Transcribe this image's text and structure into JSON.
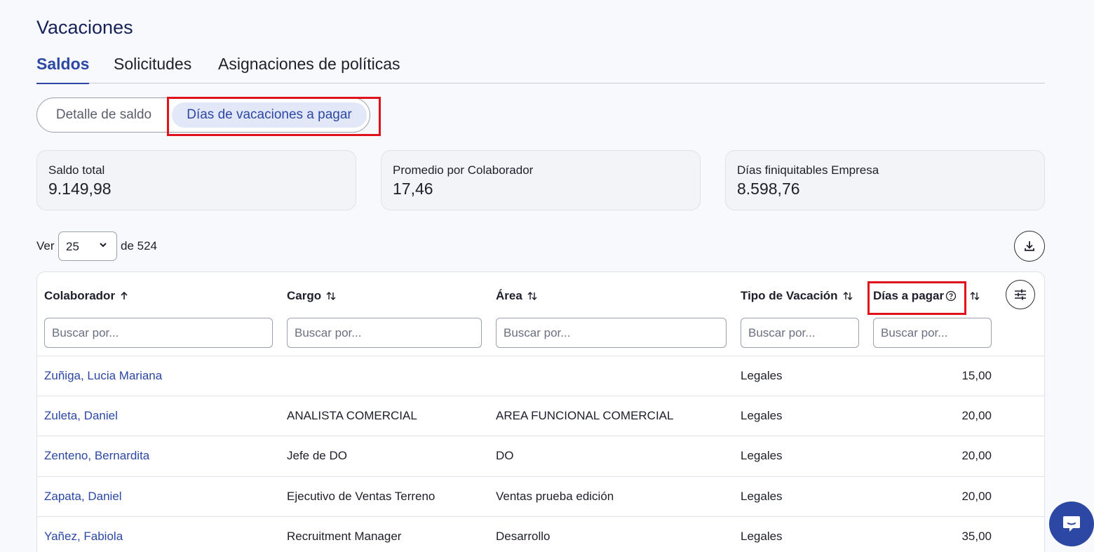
{
  "page_title": "Vacaciones",
  "tabs": [
    {
      "label": "Saldos",
      "active": true
    },
    {
      "label": "Solicitudes",
      "active": false
    },
    {
      "label": "Asignaciones de políticas",
      "active": false
    }
  ],
  "segmented": [
    {
      "label": "Detalle de saldo",
      "active": false
    },
    {
      "label": "Días de vacaciones a pagar",
      "active": true
    }
  ],
  "cards": [
    {
      "label": "Saldo total",
      "value": "9.149,98"
    },
    {
      "label": "Promedio por Colaborador",
      "value": "17,46"
    },
    {
      "label": "Días finiquitables Empresa",
      "value": "8.598,76"
    }
  ],
  "pager": {
    "prefix": "Ver",
    "page_size": "25",
    "suffix": "de 524"
  },
  "columns": [
    {
      "label": "Colaborador",
      "sort": "asc",
      "placeholder": "Buscar por..."
    },
    {
      "label": "Cargo",
      "sort": "none",
      "placeholder": "Buscar por..."
    },
    {
      "label": "Área",
      "sort": "none",
      "placeholder": "Buscar por..."
    },
    {
      "label": "Tipo de Vacación",
      "sort": "none",
      "placeholder": "Buscar por..."
    },
    {
      "label": "Días a pagar",
      "sort": "none",
      "placeholder": "Buscar por..."
    }
  ],
  "rows": [
    {
      "colaborador": "Zuñiga, Lucia Mariana",
      "cargo": "",
      "area": "",
      "tipo": "Legales",
      "dias": "15,00"
    },
    {
      "colaborador": "Zuleta, Daniel",
      "cargo": "ANALISTA COMERCIAL",
      "area": "AREA FUNCIONAL COMERCIAL",
      "tipo": "Legales",
      "dias": "20,00"
    },
    {
      "colaborador": "Zenteno, Bernardita",
      "cargo": "Jefe de DO",
      "area": "DO",
      "tipo": "Legales",
      "dias": "20,00"
    },
    {
      "colaborador": "Zapata, Daniel",
      "cargo": "Ejecutivo de Ventas Terreno",
      "area": "Ventas prueba edición",
      "tipo": "Legales",
      "dias": "20,00"
    },
    {
      "colaborador": "Yañez, Fabiola",
      "cargo": "Recruitment Manager",
      "area": "Desarrollo",
      "tipo": "Legales",
      "dias": "35,00"
    }
  ],
  "icons": {
    "download": "download-icon",
    "column_settings": "sliders-icon",
    "help": "question-circle-icon",
    "chat": "chat-icon"
  },
  "colors": {
    "accent": "#2c47a4",
    "highlight": "#e0121c"
  }
}
